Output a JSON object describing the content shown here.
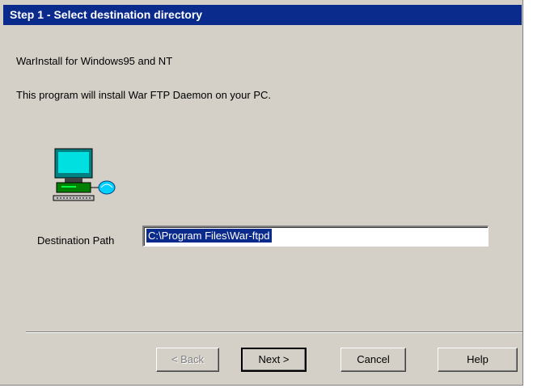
{
  "window": {
    "title": "Step 1 - Select destination directory"
  },
  "content": {
    "line1": "WarInstall for Windows95 and NT",
    "line2": "This program will install War FTP Daemon on your PC.",
    "icon": "computer-network-icon"
  },
  "destination": {
    "label": "Destination Path",
    "value": "C:\\Program Files\\War-ftpd"
  },
  "buttons": {
    "back": "< Back",
    "next": "Next >",
    "cancel": "Cancel",
    "help": "Help"
  },
  "colors": {
    "title_bar": "#0a2a8c",
    "dialog_bg": "#d4d0c8",
    "selection": "#0a2a8c"
  }
}
